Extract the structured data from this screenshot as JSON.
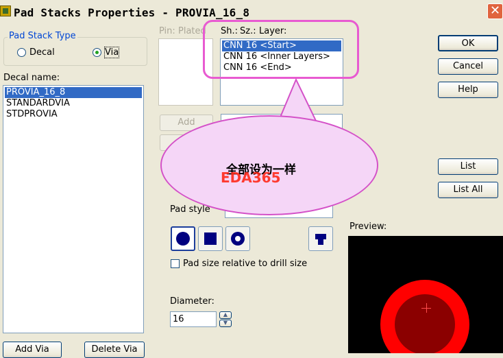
{
  "window": {
    "title": "Pad Stacks Properties - PROVIA_16_8",
    "close": "✕"
  },
  "pad_stack_type": {
    "legend": "Pad Stack Type",
    "options": [
      {
        "label": "Decal",
        "selected": false
      },
      {
        "label": "Via",
        "selected": true
      }
    ]
  },
  "decal": {
    "label": "Decal name:",
    "items": [
      {
        "label": "PROVIA_16_8",
        "selected": true
      },
      {
        "label": "STANDARDVIA",
        "selected": false
      },
      {
        "label": "STDPROVIA",
        "selected": false
      }
    ]
  },
  "pin_list": {
    "header_pin": "Pin:",
    "header_plated": "Plated"
  },
  "layers": {
    "headers": {
      "shape": "Sh.:",
      "size": "Sz.:",
      "layer": "Layer:"
    },
    "items": [
      {
        "label": "CNN 16 <Start>",
        "selected": true
      },
      {
        "label": "CNN 16 <Inner Layers>",
        "selected": false
      },
      {
        "label": "CNN 16 <End>",
        "selected": false
      }
    ]
  },
  "buttons": {
    "ok": "OK",
    "cancel": "Cancel",
    "help": "Help",
    "list": "List",
    "list_all": "List All",
    "add": "Add",
    "add_via": "Add Via",
    "delete_via": "Delete Via"
  },
  "pad_style": {
    "label": "Pad style"
  },
  "shapes": [
    "round-pad",
    "square-pad",
    "annular-pad",
    "custom-pad"
  ],
  "relative": {
    "label": "Pad size relative to drill size",
    "checked": false
  },
  "diameter": {
    "label": "Diameter:",
    "value": "16"
  },
  "preview": {
    "label": "Preview:"
  },
  "annotation": {
    "text": "全部设为一样",
    "watermark": "EDA365"
  },
  "colors": {
    "accent": "#316ac5",
    "callout": "#e85ad1",
    "pad": "#ff0000",
    "drill": "#8b0000"
  }
}
